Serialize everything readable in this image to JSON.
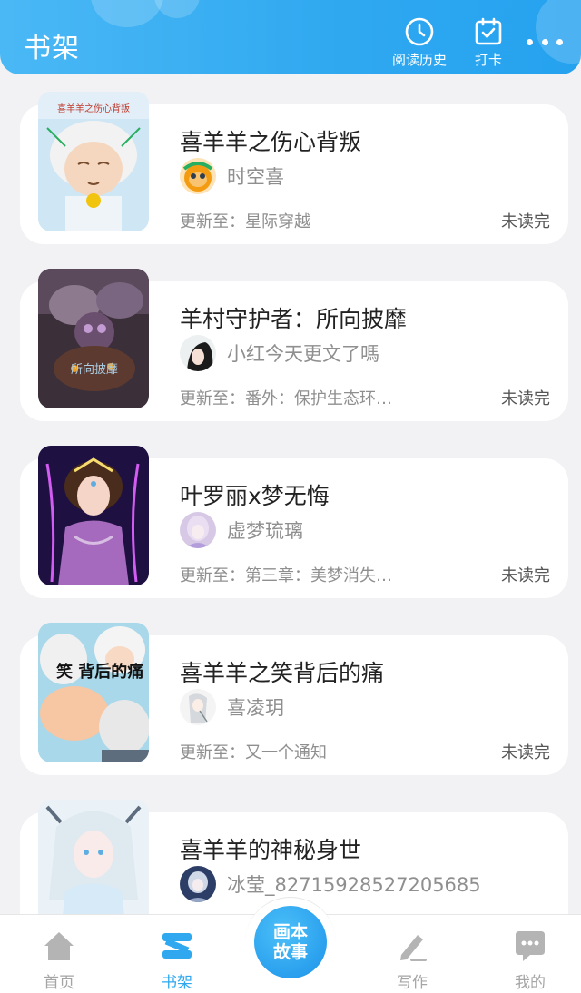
{
  "header": {
    "title": "书架",
    "history_label": "阅读历史",
    "checkin_label": "打卡"
  },
  "colors": {
    "brand": "#2fa8f0",
    "header_gradient_start": "#4ab8f5",
    "text_muted": "#8f8f8f"
  },
  "books": [
    {
      "title": "喜羊羊之伤心背叛",
      "author": "时空喜",
      "update_prefix": "更新至：",
      "update": "星际穿越",
      "status": "未读完",
      "cover_text": "喜羊羊之伤心背叛"
    },
    {
      "title": "羊村守护者：所向披靡",
      "author": "小红今天更文了嗎",
      "update_prefix": "更新至：",
      "update": "番外：保护生态环…",
      "status": "未读完",
      "cover_text": "所向披靡"
    },
    {
      "title": "叶罗丽x梦无悔",
      "author": "虚梦琉璃",
      "update_prefix": "更新至：",
      "update": "第三章：美梦消失…",
      "status": "未读完",
      "cover_text": ""
    },
    {
      "title": "喜羊羊之笑背后的痛",
      "author": "喜凌玥",
      "update_prefix": "更新至：",
      "update": "又一个通知",
      "status": "未读完",
      "cover_text": "笑 背后的痛"
    },
    {
      "title": "喜羊羊的神秘身世",
      "author": "冰莹_82715928527205685",
      "update_prefix": "",
      "update": "",
      "status": "",
      "cover_text": ""
    }
  ],
  "nav": {
    "home": "首页",
    "shelf": "书架",
    "center_line1": "画本",
    "center_line2": "故事",
    "write": "写作",
    "mine": "我的"
  }
}
